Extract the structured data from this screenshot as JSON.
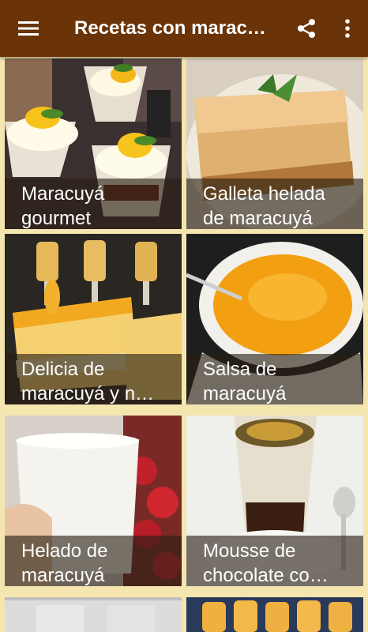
{
  "app_bar": {
    "title": "Recetas con marac…",
    "icons": [
      "menu-icon",
      "share-icon",
      "more-vert-icon"
    ],
    "bg_color": "#6a3408",
    "icon_color": "#ffffff"
  },
  "grid": {
    "background": "#f5e6b0",
    "recipes": [
      {
        "line1": "Maracuyá",
        "line2": "gourmet"
      },
      {
        "line1": "Galleta helada",
        "line2": "de maracuyá"
      },
      {
        "line1": "Delicia de",
        "line2": "maracuyá y n…"
      },
      {
        "line1": "Salsa de",
        "line2": "maracuyá"
      },
      {
        "line1": "Helado de",
        "line2": "maracuyá"
      },
      {
        "line1": "Mousse de",
        "line2": "chocolate co…"
      }
    ]
  }
}
